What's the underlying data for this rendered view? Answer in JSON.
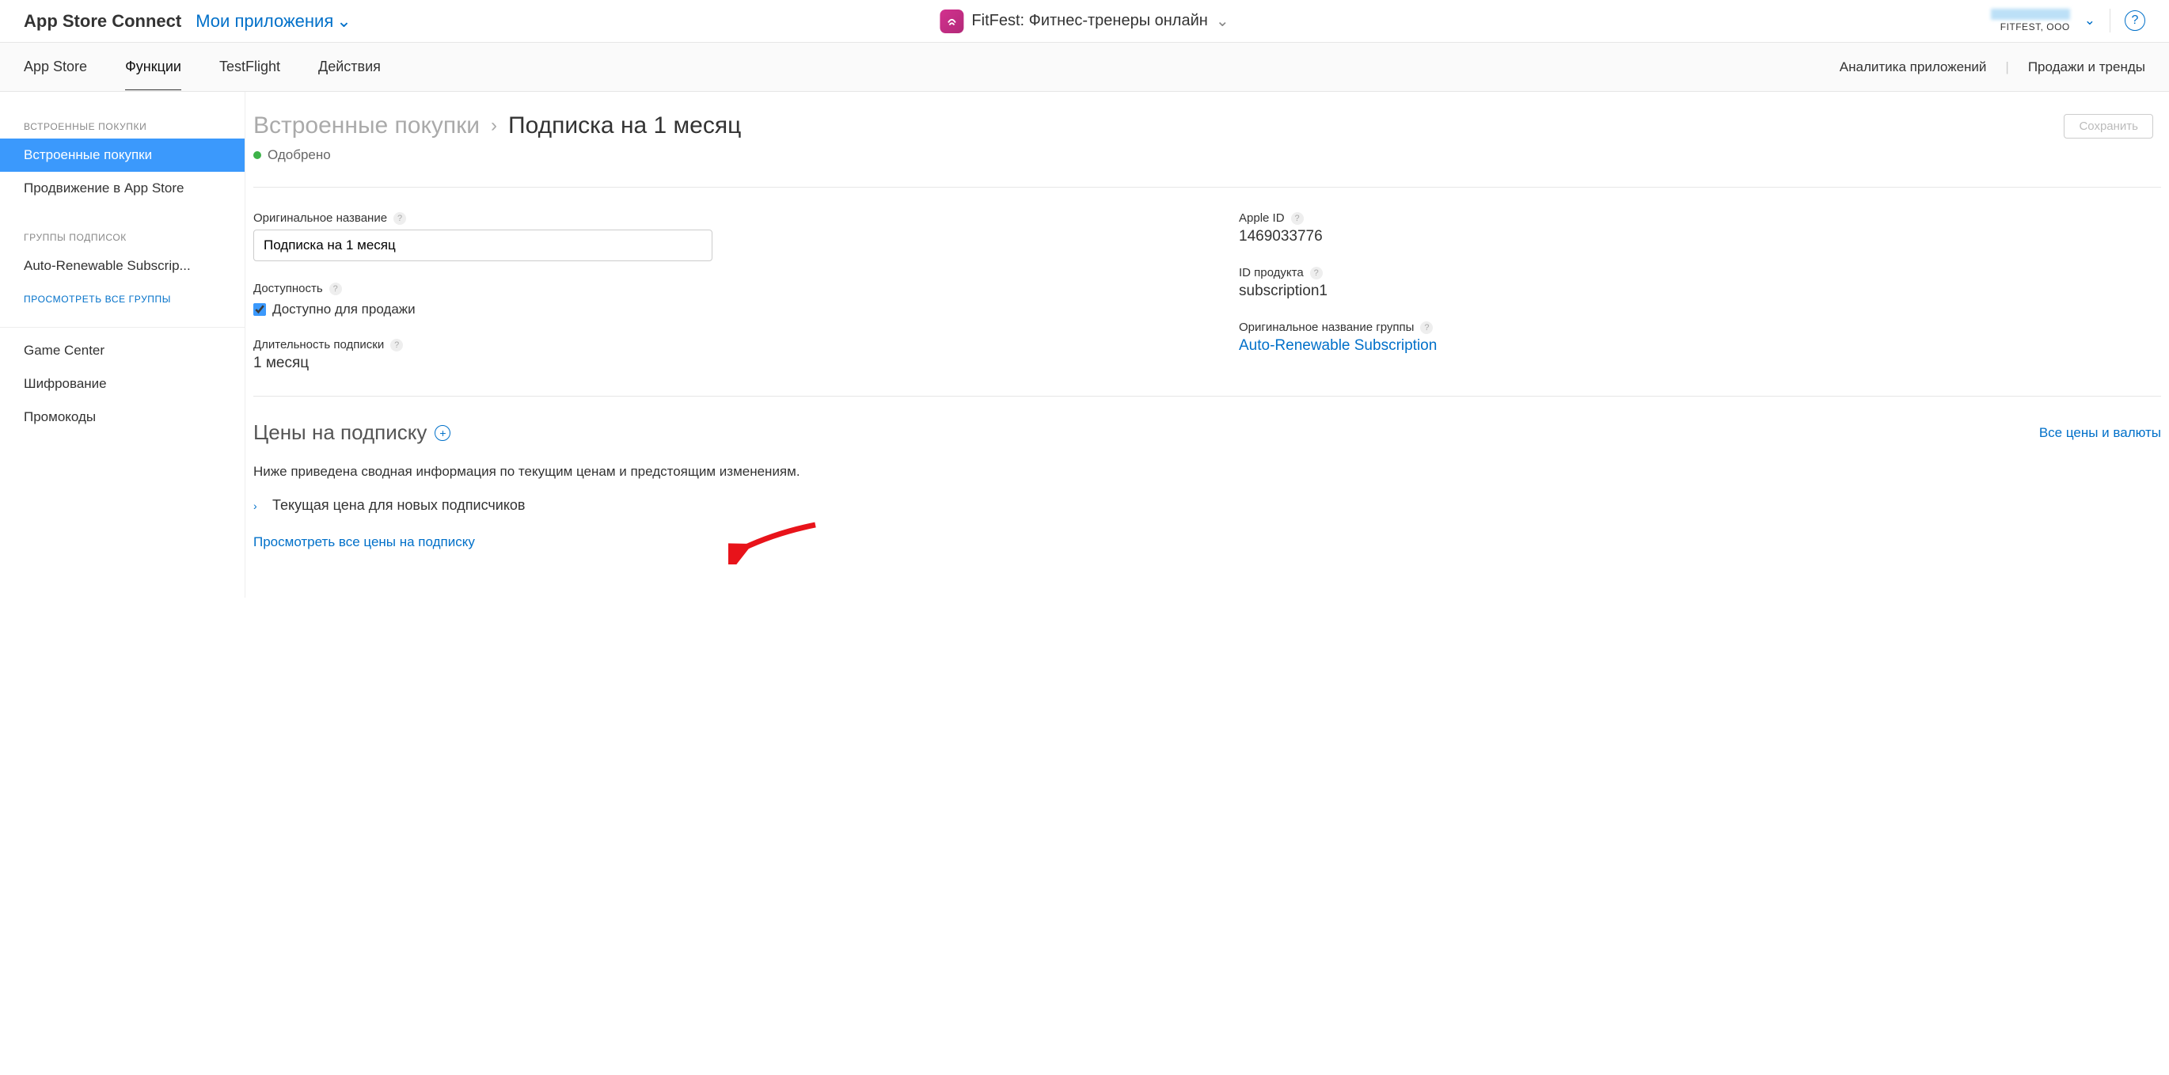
{
  "header": {
    "brand": "App Store Connect",
    "apps_dropdown": "Мои приложения",
    "app_name": "FitFest: Фитнес-тренеры онлайн",
    "account_org": "FITFEST, OOO"
  },
  "tabs": {
    "items": [
      "App Store",
      "Функции",
      "TestFlight",
      "Действия"
    ],
    "active_index": 1,
    "right": {
      "analytics": "Аналитика приложений",
      "sales": "Продажи и тренды"
    }
  },
  "sidebar": {
    "section_iap": "ВСТРОЕННЫЕ ПОКУПКИ",
    "iap_items": [
      "Встроенные покупки",
      "Продвижение в App Store"
    ],
    "iap_active_index": 0,
    "section_groups": "ГРУППЫ ПОДПИСОК",
    "group_item": "Auto-Renewable Subscrip...",
    "view_all_groups": "ПРОСМОТРЕТЬ ВСЕ ГРУППЫ",
    "bottom_items": [
      "Game Center",
      "Шифрование",
      "Промокоды"
    ]
  },
  "breadcrumb": {
    "parent": "Встроенные покупки",
    "current": "Подписка на 1 месяц"
  },
  "status": {
    "text": "Одобрено"
  },
  "save_button": "Сохранить",
  "fields": {
    "original_name_label": "Оригинальное название",
    "original_name_value": "Подписка на 1 месяц",
    "availability_label": "Доступность",
    "availability_checkbox": "Доступно для продажи",
    "duration_label": "Длительность подписки",
    "duration_value": "1 месяц",
    "apple_id_label": "Apple ID",
    "apple_id_value": "1469033776",
    "product_id_label": "ID продукта",
    "product_id_value": "subscription1",
    "group_name_label": "Оригинальное название группы",
    "group_name_value": "Auto-Renewable Subscription"
  },
  "prices_section": {
    "heading": "Цены на подписку",
    "all_prices_link": "Все цены и валюты",
    "desc": "Ниже приведена сводная информация по текущим ценам и предстоящим изменениям.",
    "current_price_label": "Текущая цена для новых подписчиков",
    "view_all_link": "Просмотреть все цены на подписку"
  }
}
